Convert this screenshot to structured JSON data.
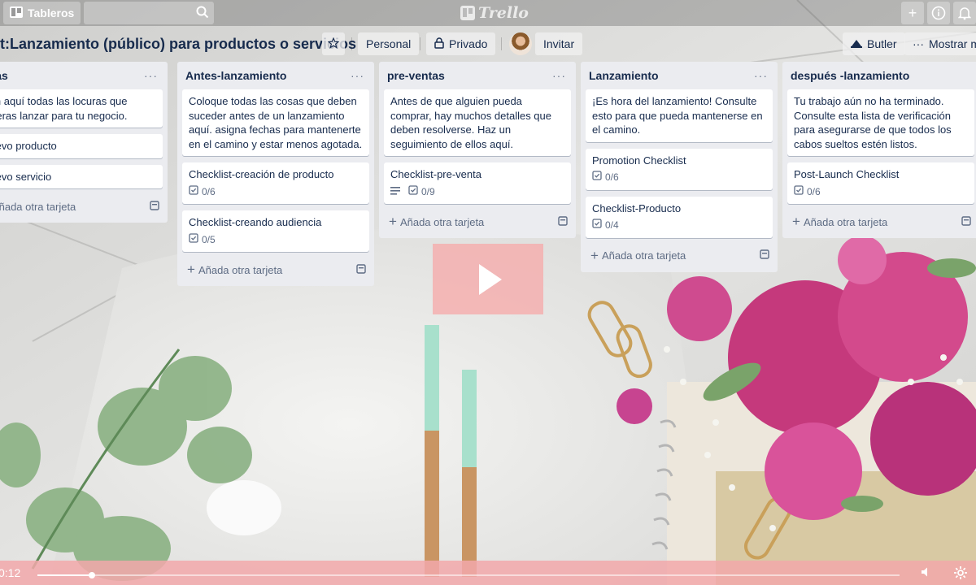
{
  "topnav": {
    "boards_label": "Tableros",
    "logo_text": "Trello",
    "icons": [
      "boards-icon",
      "search-icon",
      "add-icon",
      "info-icon",
      "bell-icon"
    ]
  },
  "board": {
    "title": "t:Lanzamiento (público) para productos o servicios",
    "visibility_team": "Personal",
    "visibility_privacy": "Privado",
    "invite_label": "Invitar",
    "butler_label": "Butler",
    "menu_label": "Mostrar menú"
  },
  "lists": [
    {
      "title": "Ideas",
      "cards": [
        {
          "text": "Pon aquí todas las locuras que quieras lanzar para tu negocio."
        },
        {
          "text": "Nuevo producto"
        },
        {
          "text": "Nuevo servicio"
        }
      ],
      "add_label": "Añada otra tarjeta"
    },
    {
      "title": "Antes-lanzamiento",
      "cards": [
        {
          "text": "Coloque todas las cosas que deben suceder antes de un lanzamiento aquí. asigna fechas para mantenerte en el camino y estar menos agotada."
        },
        {
          "text": "Checklist-creación de producto",
          "checklist": "0/6"
        },
        {
          "text": "Checklist-creando audiencia",
          "checklist": "0/5"
        }
      ],
      "add_label": "Añada otra tarjeta"
    },
    {
      "title": "pre-ventas",
      "cards": [
        {
          "text": "Antes de que alguien pueda comprar, hay muchos detalles que deben resolverse. Haz un seguimiento de ellos aquí."
        },
        {
          "text": "Checklist-pre-venta",
          "description": true,
          "checklist": "0/9"
        }
      ],
      "add_label": "Añada otra tarjeta"
    },
    {
      "title": "Lanzamiento",
      "cards": [
        {
          "text": "¡Es hora del lanzamiento! Consulte esto para que pueda mantenerse en el camino."
        },
        {
          "text": "Promotion Checklist",
          "checklist": "0/6"
        },
        {
          "text": "Checklist-Producto",
          "checklist": "0/4"
        }
      ],
      "add_label": "Añada otra tarjeta"
    },
    {
      "title": "después -lanzamiento",
      "cards": [
        {
          "text": "Tu trabajo aún no ha terminado. Consulte esta lista de verificación para asegurarse de que todos los cabos sueltos estén listos."
        },
        {
          "text": "Post-Launch Checklist",
          "checklist": "0/6"
        }
      ],
      "add_label": "Añada otra tarjeta"
    }
  ],
  "video": {
    "time": "0:12",
    "progress": 0.063,
    "overlay_color": "#f4a9aa"
  }
}
